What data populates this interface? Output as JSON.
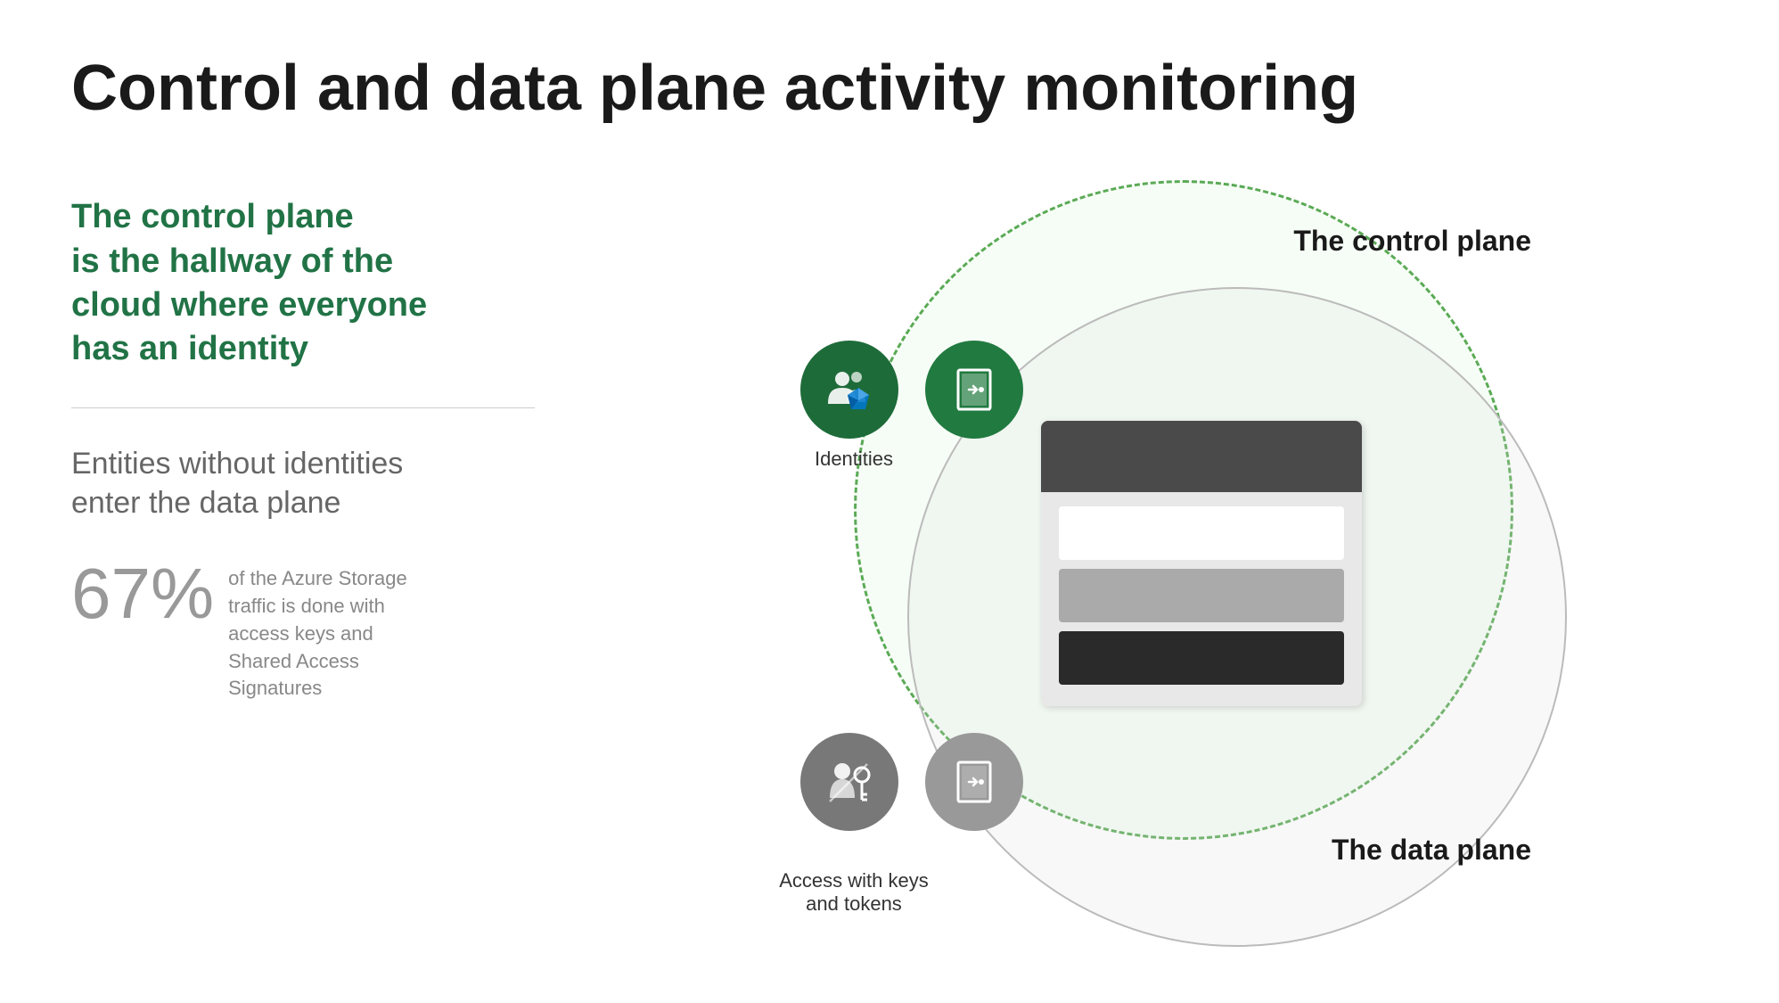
{
  "page": {
    "title": "Control and data plane activity monitoring",
    "green_text": {
      "line1": "The control plane",
      "line2": "is the hallway of the",
      "line3": "cloud where everyone",
      "line4": "has an identity"
    },
    "data_plane_subtitle": "Entities without identities\nenter the data plane",
    "stat_number": "67%",
    "stat_description": "of the Azure Storage traffic is done with access keys and Shared Access Signatures",
    "diagram": {
      "control_plane_label": "The control plane",
      "data_plane_label": "The data plane",
      "identities_label": "Identities",
      "access_label": "Access with keys\nand tokens"
    }
  }
}
